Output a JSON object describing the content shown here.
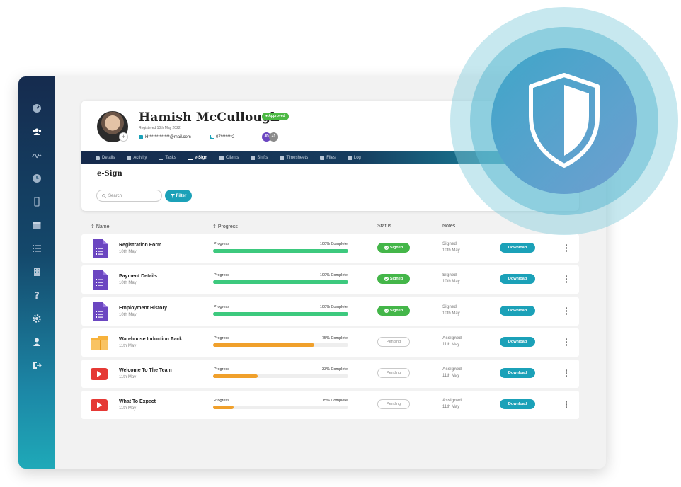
{
  "profile": {
    "name": "Hamish McCullough",
    "status_badge": "Approved",
    "registered": "Registered 10th May 2022",
    "email": "H*************@mail.com",
    "phone": "07*******2",
    "viewers": [
      "JD",
      "+1"
    ]
  },
  "tabs": [
    {
      "label": "Details",
      "icon": "user-icon"
    },
    {
      "label": "Activity",
      "icon": "activity-icon"
    },
    {
      "label": "Tasks",
      "icon": "tasks-icon"
    },
    {
      "label": "e-Sign",
      "icon": "signature-icon",
      "active": true
    },
    {
      "label": "Clients",
      "icon": "clients-icon"
    },
    {
      "label": "Shifts",
      "icon": "shifts-icon"
    },
    {
      "label": "Timesheets",
      "icon": "timesheets-icon"
    },
    {
      "label": "Files",
      "icon": "folder-icon"
    },
    {
      "label": "Log",
      "icon": "log-icon"
    }
  ],
  "section_title": "e-Sign",
  "search": {
    "placeholder": "Search"
  },
  "filter_label": "Filter",
  "columns": {
    "name": "Name",
    "progress": "Progress",
    "status": "Status",
    "notes": "Notes"
  },
  "documents": [
    {
      "name": "Registration Form",
      "date": "10th May",
      "icon": "form-icon",
      "progress_label": "Progress",
      "progress_text": "100% Complete",
      "progress": 100,
      "status": "Signed",
      "note_state": "Signed",
      "note_date": "10th May",
      "action": "Download"
    },
    {
      "name": "Payment Details",
      "date": "10th May",
      "icon": "form-icon",
      "progress_label": "Progress",
      "progress_text": "100% Complete",
      "progress": 100,
      "status": "Signed",
      "note_state": "Signed",
      "note_date": "10th May",
      "action": "Download"
    },
    {
      "name": "Employment History",
      "date": "10th May",
      "icon": "form-icon",
      "progress_label": "Progress",
      "progress_text": "100% Complete",
      "progress": 100,
      "status": "Signed",
      "note_state": "Signed",
      "note_date": "10th May",
      "action": "Download"
    },
    {
      "name": "Warehouse Induction Pack",
      "date": "11th May",
      "icon": "folder-icon",
      "progress_label": "Progress",
      "progress_text": "75% Complete",
      "progress": 75,
      "status": "Pending",
      "note_state": "Assigned",
      "note_date": "11th May",
      "action": "Download"
    },
    {
      "name": "Welcome To The Team",
      "date": "11th May",
      "icon": "video-icon",
      "progress_label": "Progress",
      "progress_text": "33% Complete",
      "progress": 33,
      "status": "Pending",
      "note_state": "Assigned",
      "note_date": "11th May",
      "action": "Download"
    },
    {
      "name": "What To Expect",
      "date": "11th May",
      "icon": "video-icon",
      "progress_label": "Progress",
      "progress_text": "15% Complete",
      "progress": 15,
      "status": "Pending",
      "note_state": "Assigned",
      "note_date": "11th May",
      "action": "Download"
    }
  ],
  "sidebar_icons": [
    "dashboard-icon",
    "users-icon",
    "signature-icon",
    "clock-icon",
    "mobile-icon",
    "calendar-icon",
    "list-icon",
    "building-icon",
    "help-icon",
    "settings-icon",
    "profile-icon",
    "logout-icon"
  ],
  "colors": {
    "accent": "#1ba1b8",
    "complete": "#3dc97e",
    "partial": "#f0a02b",
    "signed": "#44b649",
    "form": "#6b46c1",
    "video": "#e53935",
    "folder": "#f7b23b",
    "nav_dark": "#152b4e"
  }
}
